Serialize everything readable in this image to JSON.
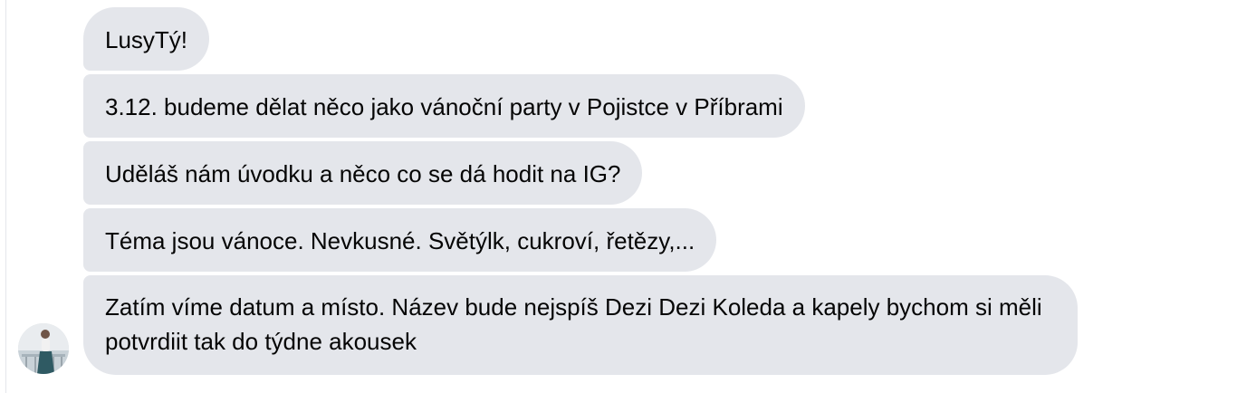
{
  "conversation": {
    "messages": [
      {
        "text": "LusyTý!"
      },
      {
        "text": "3.12. budeme dělat něco jako vánoční party v Pojistce v Příbrami"
      },
      {
        "text": "Uděláš nám úvodku a něco co se dá hodit na IG?"
      },
      {
        "text": "Téma jsou vánoce. Nevkusné. Světýlk, cukroví, řetězy,..."
      },
      {
        "text": "Zatím víme datum a místo. Název bude nejspíš Dezi Dezi Koleda a kapely bychom si měli potvrdiit tak do týdne akousek"
      }
    ]
  },
  "colors": {
    "bubble": "#e4e6eb",
    "text": "#050505"
  }
}
